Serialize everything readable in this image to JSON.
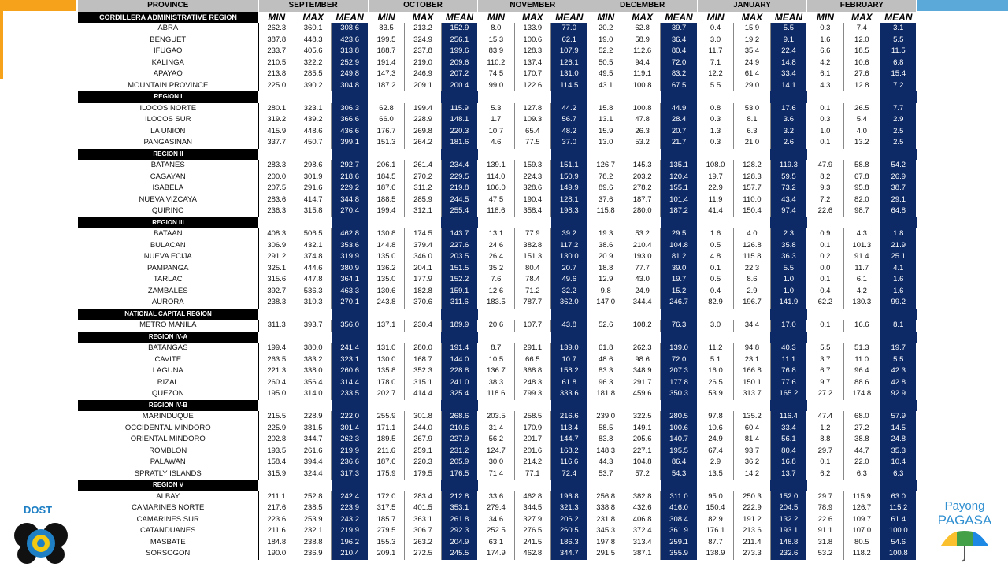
{
  "header": {
    "province_label": "PROVINCE",
    "months": [
      "SEPTEMBER",
      "OCTOBER",
      "NOVEMBER",
      "DECEMBER",
      "JANUARY",
      "FEBRUARY"
    ],
    "stats": [
      "MIN",
      "MAX",
      "MEAN"
    ],
    "first_region": "CORDILLERA ADMINISTRATIVE REGION"
  },
  "rows": [
    {
      "name": "ABRA",
      "v": [
        "262.3",
        "360.1",
        "308.6",
        "83.5",
        "213.2",
        "152.9",
        "8.0",
        "133.9",
        "77.0",
        "20.2",
        "62.8",
        "39.7",
        "0.4",
        "15.9",
        "5.5",
        "0.3",
        "7.4",
        "3.1"
      ]
    },
    {
      "name": "BENGUET",
      "v": [
        "387.8",
        "448.3",
        "423.6",
        "199.5",
        "324.9",
        "256.1",
        "15.3",
        "100.6",
        "62.1",
        "19.0",
        "58.9",
        "36.4",
        "3.0",
        "19.2",
        "9.1",
        "1.6",
        "12.0",
        "5.5"
      ]
    },
    {
      "name": "IFUGAO",
      "v": [
        "233.7",
        "405.6",
        "313.8",
        "188.7",
        "237.8",
        "199.6",
        "83.9",
        "128.3",
        "107.9",
        "52.2",
        "112.6",
        "80.4",
        "11.7",
        "35.4",
        "22.4",
        "6.6",
        "18.5",
        "11.5"
      ]
    },
    {
      "name": "KALINGA",
      "v": [
        "210.5",
        "322.2",
        "252.9",
        "191.4",
        "219.0",
        "209.6",
        "110.2",
        "137.4",
        "126.1",
        "50.5",
        "94.4",
        "72.0",
        "7.1",
        "24.9",
        "14.8",
        "4.2",
        "10.6",
        "6.8"
      ]
    },
    {
      "name": "APAYAO",
      "v": [
        "213.8",
        "285.5",
        "249.8",
        "147.3",
        "246.9",
        "207.2",
        "74.5",
        "170.7",
        "131.0",
        "49.5",
        "119.1",
        "83.2",
        "12.2",
        "61.4",
        "33.4",
        "6.1",
        "27.6",
        "15.4"
      ]
    },
    {
      "name": "MOUNTAIN PROVINCE",
      "v": [
        "225.0",
        "390.2",
        "304.8",
        "187.2",
        "209.1",
        "200.4",
        "99.0",
        "122.6",
        "114.5",
        "43.1",
        "100.8",
        "67.5",
        "5.5",
        "29.0",
        "14.1",
        "4.3",
        "12.8",
        "7.2"
      ]
    },
    {
      "region": "REGION I"
    },
    {
      "name": "ILOCOS NORTE",
      "v": [
        "280.1",
        "323.1",
        "306.3",
        "62.8",
        "199.4",
        "115.9",
        "5.3",
        "127.8",
        "44.2",
        "15.8",
        "100.8",
        "44.9",
        "0.8",
        "53.0",
        "17.6",
        "0.1",
        "26.5",
        "7.7"
      ]
    },
    {
      "name": "ILOCOS SUR",
      "v": [
        "319.2",
        "439.2",
        "366.6",
        "66.0",
        "228.9",
        "148.1",
        "1.7",
        "109.3",
        "56.7",
        "13.1",
        "47.8",
        "28.4",
        "0.3",
        "8.1",
        "3.6",
        "0.3",
        "5.4",
        "2.9"
      ]
    },
    {
      "name": "LA UNION",
      "v": [
        "415.9",
        "448.6",
        "436.6",
        "176.7",
        "269.8",
        "220.3",
        "10.7",
        "65.4",
        "48.2",
        "15.9",
        "26.3",
        "20.7",
        "1.3",
        "6.3",
        "3.2",
        "1.0",
        "4.0",
        "2.5"
      ]
    },
    {
      "name": "PANGASINAN",
      "v": [
        "337.7",
        "450.7",
        "399.1",
        "151.3",
        "264.2",
        "181.6",
        "4.6",
        "77.5",
        "37.0",
        "13.0",
        "53.2",
        "21.7",
        "0.3",
        "21.0",
        "2.6",
        "0.1",
        "13.2",
        "2.5"
      ]
    },
    {
      "region": "REGION II"
    },
    {
      "name": "BATANES",
      "v": [
        "283.3",
        "298.6",
        "292.7",
        "206.1",
        "261.4",
        "234.4",
        "139.1",
        "159.3",
        "151.1",
        "126.7",
        "145.3",
        "135.1",
        "108.0",
        "128.2",
        "119.3",
        "47.9",
        "58.8",
        "54.2"
      ]
    },
    {
      "name": "CAGAYAN",
      "v": [
        "200.0",
        "301.9",
        "218.6",
        "184.5",
        "270.2",
        "229.5",
        "114.0",
        "224.3",
        "150.9",
        "78.2",
        "203.2",
        "120.4",
        "19.7",
        "128.3",
        "59.5",
        "8.2",
        "67.8",
        "26.9"
      ]
    },
    {
      "name": "ISABELA",
      "v": [
        "207.5",
        "291.6",
        "229.2",
        "187.6",
        "311.2",
        "219.8",
        "106.0",
        "328.6",
        "149.9",
        "89.6",
        "278.2",
        "155.1",
        "22.9",
        "157.7",
        "73.2",
        "9.3",
        "95.8",
        "38.7"
      ]
    },
    {
      "name": "NUEVA VIZCAYA",
      "v": [
        "283.6",
        "414.7",
        "344.8",
        "188.5",
        "285.9",
        "244.5",
        "47.5",
        "190.4",
        "128.1",
        "37.6",
        "187.7",
        "101.4",
        "11.9",
        "110.0",
        "43.4",
        "7.2",
        "82.0",
        "29.1"
      ]
    },
    {
      "name": "QUIRINO",
      "v": [
        "236.3",
        "315.8",
        "270.4",
        "199.4",
        "312.1",
        "255.4",
        "118.6",
        "358.4",
        "198.3",
        "115.8",
        "280.0",
        "187.2",
        "41.4",
        "150.4",
        "97.4",
        "22.6",
        "98.7",
        "64.8"
      ]
    },
    {
      "region": "REGION III"
    },
    {
      "name": "BATAAN",
      "v": [
        "408.3",
        "506.5",
        "462.8",
        "130.8",
        "174.5",
        "143.7",
        "13.1",
        "77.9",
        "39.2",
        "19.3",
        "53.2",
        "29.5",
        "1.6",
        "4.0",
        "2.3",
        "0.9",
        "4.3",
        "1.8"
      ]
    },
    {
      "name": "BULACAN",
      "v": [
        "306.9",
        "432.1",
        "353.6",
        "144.8",
        "379.4",
        "227.6",
        "24.6",
        "382.8",
        "117.2",
        "38.6",
        "210.4",
        "104.8",
        "0.5",
        "126.8",
        "35.8",
        "0.1",
        "101.3",
        "21.9"
      ]
    },
    {
      "name": "NUEVA ECIJA",
      "v": [
        "291.2",
        "374.8",
        "319.9",
        "135.0",
        "346.0",
        "203.5",
        "26.4",
        "151.3",
        "130.0",
        "20.9",
        "193.0",
        "81.2",
        "4.8",
        "115.8",
        "36.3",
        "0.2",
        "91.4",
        "25.1"
      ]
    },
    {
      "name": "PAMPANGA",
      "v": [
        "325.1",
        "444.6",
        "380.9",
        "136.2",
        "204.1",
        "151.5",
        "35.2",
        "80.4",
        "20.7",
        "18.8",
        "77.7",
        "39.0",
        "0.1",
        "22.3",
        "5.5",
        "0.0",
        "11.7",
        "4.1"
      ]
    },
    {
      "name": "TARLAC",
      "v": [
        "315.6",
        "447.8",
        "364.1",
        "135.0",
        "177.9",
        "152.2",
        "7.6",
        "78.4",
        "49.6",
        "12.9",
        "43.0",
        "19.7",
        "0.5",
        "8.6",
        "1.0",
        "0.1",
        "6.1",
        "1.6"
      ]
    },
    {
      "name": "ZAMBALES",
      "v": [
        "392.7",
        "536.3",
        "463.3",
        "130.6",
        "182.8",
        "159.1",
        "12.6",
        "71.2",
        "32.2",
        "9.8",
        "24.9",
        "15.2",
        "0.4",
        "2.9",
        "1.0",
        "0.4",
        "4.2",
        "1.6"
      ]
    },
    {
      "name": "AURORA",
      "v": [
        "238.3",
        "310.3",
        "270.1",
        "243.8",
        "370.6",
        "311.6",
        "183.5",
        "787.7",
        "362.0",
        "147.0",
        "344.4",
        "246.7",
        "82.9",
        "196.7",
        "141.9",
        "62.2",
        "130.3",
        "99.2"
      ]
    },
    {
      "region": "NATIONAL CAPITAL REGION"
    },
    {
      "name": "METRO MANILA",
      "v": [
        "311.3",
        "393.7",
        "356.0",
        "137.1",
        "230.4",
        "189.9",
        "20.6",
        "107.7",
        "43.8",
        "52.6",
        "108.2",
        "76.3",
        "3.0",
        "34.4",
        "17.0",
        "0.1",
        "16.6",
        "8.1"
      ]
    },
    {
      "region": "REGION IV-A"
    },
    {
      "name": "BATANGAS",
      "v": [
        "199.4",
        "380.0",
        "241.4",
        "131.0",
        "280.0",
        "191.4",
        "8.7",
        "291.1",
        "139.0",
        "61.8",
        "262.3",
        "139.0",
        "11.2",
        "94.8",
        "40.3",
        "5.5",
        "51.3",
        "19.7"
      ]
    },
    {
      "name": "CAVITE",
      "v": [
        "263.5",
        "383.2",
        "323.1",
        "130.0",
        "168.7",
        "144.0",
        "10.5",
        "66.5",
        "10.7",
        "48.6",
        "98.6",
        "72.0",
        "5.1",
        "23.1",
        "11.1",
        "3.7",
        "11.0",
        "5.5"
      ]
    },
    {
      "name": "LAGUNA",
      "v": [
        "221.3",
        "338.0",
        "260.6",
        "135.8",
        "352.3",
        "228.8",
        "136.7",
        "368.8",
        "158.2",
        "83.3",
        "348.9",
        "207.3",
        "16.0",
        "166.8",
        "76.8",
        "6.7",
        "96.4",
        "42.3"
      ]
    },
    {
      "name": "RIZAL",
      "v": [
        "260.4",
        "356.4",
        "314.4",
        "178.0",
        "315.1",
        "241.0",
        "38.3",
        "248.3",
        "61.8",
        "96.3",
        "291.7",
        "177.8",
        "26.5",
        "150.1",
        "77.6",
        "9.7",
        "88.6",
        "42.8"
      ]
    },
    {
      "name": "QUEZON",
      "v": [
        "195.0",
        "314.0",
        "233.5",
        "202.7",
        "414.4",
        "325.4",
        "118.6",
        "799.3",
        "333.6",
        "181.8",
        "459.6",
        "350.3",
        "53.9",
        "313.7",
        "165.2",
        "27.2",
        "174.8",
        "92.9"
      ]
    },
    {
      "region": "REGION IV-B"
    },
    {
      "name": "MARINDUQUE",
      "v": [
        "215.5",
        "228.9",
        "222.0",
        "255.9",
        "301.8",
        "268.6",
        "203.5",
        "258.5",
        "216.6",
        "239.0",
        "322.5",
        "280.5",
        "97.8",
        "135.2",
        "116.4",
        "47.4",
        "68.0",
        "57.9"
      ]
    },
    {
      "name": "OCCIDENTAL MINDORO",
      "v": [
        "225.9",
        "381.5",
        "301.4",
        "171.1",
        "244.0",
        "210.6",
        "31.4",
        "170.9",
        "113.4",
        "58.5",
        "149.1",
        "100.6",
        "10.6",
        "60.4",
        "33.4",
        "1.2",
        "27.2",
        "14.5"
      ]
    },
    {
      "name": "ORIENTAL MINDORO",
      "v": [
        "202.8",
        "344.7",
        "262.3",
        "189.5",
        "267.9",
        "227.9",
        "56.2",
        "201.7",
        "144.7",
        "83.8",
        "205.6",
        "140.7",
        "24.9",
        "81.4",
        "56.1",
        "8.8",
        "38.8",
        "24.8"
      ]
    },
    {
      "name": "ROMBLON",
      "v": [
        "193.5",
        "261.6",
        "219.9",
        "211.6",
        "259.1",
        "231.2",
        "124.7",
        "201.6",
        "168.2",
        "148.3",
        "227.1",
        "195.5",
        "67.4",
        "93.7",
        "80.4",
        "29.7",
        "44.7",
        "35.3"
      ]
    },
    {
      "name": "PALAWAN",
      "v": [
        "158.4",
        "394.4",
        "236.6",
        "187.6",
        "220.3",
        "205.9",
        "30.0",
        "214.2",
        "116.6",
        "44.3",
        "104.8",
        "86.4",
        "2.9",
        "36.2",
        "16.8",
        "0.1",
        "22.0",
        "10.4"
      ]
    },
    {
      "name": "SPRATLY ISLANDS",
      "v": [
        "315.9",
        "324.4",
        "317.3",
        "175.9",
        "179.5",
        "176.5",
        "71.4",
        "77.1",
        "72.4",
        "53.7",
        "57.2",
        "54.3",
        "13.5",
        "14.2",
        "13.7",
        "6.2",
        "6.3",
        "6.3"
      ]
    },
    {
      "region": "REGION V"
    },
    {
      "name": "ALBAY",
      "v": [
        "211.1",
        "252.8",
        "242.4",
        "172.0",
        "283.4",
        "212.8",
        "33.6",
        "462.8",
        "196.8",
        "256.8",
        "382.8",
        "311.0",
        "95.0",
        "250.3",
        "152.0",
        "29.7",
        "115.9",
        "63.0"
      ]
    },
    {
      "name": "CAMARINES NORTE",
      "v": [
        "217.6",
        "238.5",
        "223.9",
        "317.5",
        "401.5",
        "353.1",
        "279.4",
        "344.5",
        "321.3",
        "338.8",
        "432.6",
        "416.0",
        "150.4",
        "222.9",
        "204.5",
        "78.9",
        "126.7",
        "115.2"
      ]
    },
    {
      "name": "CAMARINES SUR",
      "v": [
        "223.6",
        "253.9",
        "243.2",
        "185.7",
        "363.1",
        "261.8",
        "34.6",
        "327.9",
        "206.2",
        "231.8",
        "406.8",
        "308.4",
        "82.9",
        "191.2",
        "132.2",
        "22.6",
        "109.7",
        "61.4"
      ]
    },
    {
      "name": "CATANDUANES",
      "v": [
        "211.6",
        "232.1",
        "219.9",
        "279.5",
        "306.7",
        "292.3",
        "252.5",
        "276.5",
        "260.5",
        "345.3",
        "372.4",
        "361.9",
        "176.1",
        "213.6",
        "193.1",
        "91.1",
        "107.0",
        "100.0"
      ]
    },
    {
      "name": "MASBATE",
      "v": [
        "184.8",
        "238.8",
        "196.2",
        "155.3",
        "263.2",
        "204.9",
        "63.1",
        "241.5",
        "186.3",
        "197.8",
        "313.4",
        "259.1",
        "87.7",
        "211.4",
        "148.8",
        "31.8",
        "80.5",
        "54.6"
      ]
    },
    {
      "name": "SORSOGON",
      "v": [
        "190.0",
        "236.9",
        "210.4",
        "209.1",
        "272.5",
        "245.5",
        "174.9",
        "462.8",
        "344.7",
        "291.5",
        "387.1",
        "355.9",
        "138.9",
        "273.3",
        "232.6",
        "53.2",
        "118.2",
        "100.8"
      ]
    }
  ],
  "logos": {
    "dost_label": "DOST",
    "pagasa_line1": "Payong",
    "pagasa_line2": "PAGASA"
  },
  "colors": {
    "accent_orange": "#f7a21b",
    "accent_blue": "#5aa9d9",
    "mean_cell": "#0d2a67",
    "header_gray": "#bfbfbf"
  }
}
